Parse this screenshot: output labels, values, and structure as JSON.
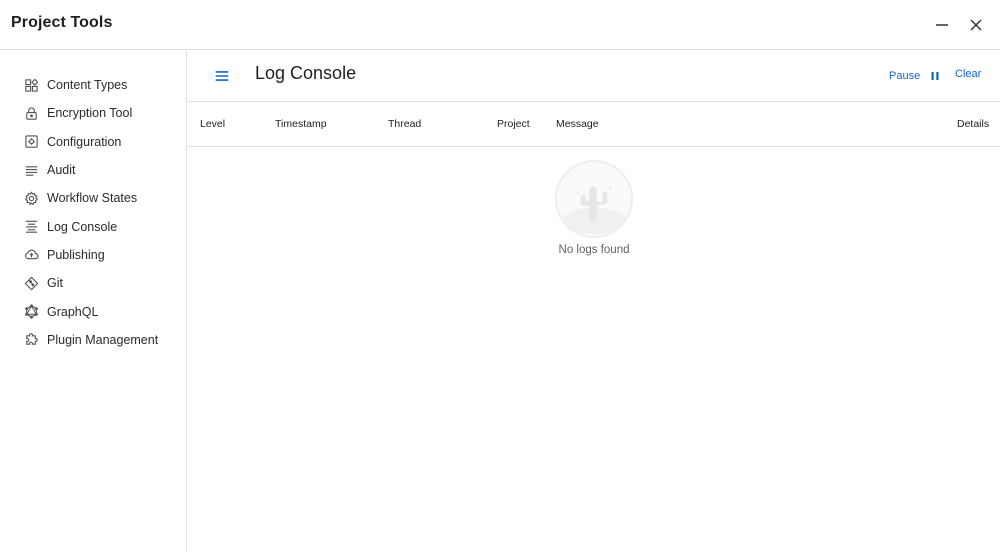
{
  "window": {
    "title": "Project Tools"
  },
  "sidebar": {
    "items": [
      {
        "label": "Content Types",
        "icon": "content-types-icon"
      },
      {
        "label": "Encryption Tool",
        "icon": "lock-icon"
      },
      {
        "label": "Configuration",
        "icon": "configuration-icon"
      },
      {
        "label": "Audit",
        "icon": "audit-icon"
      },
      {
        "label": "Workflow States",
        "icon": "gear-icon"
      },
      {
        "label": "Log Console",
        "icon": "log-console-icon"
      },
      {
        "label": "Publishing",
        "icon": "cloud-upload-icon"
      },
      {
        "label": "Git",
        "icon": "git-icon"
      },
      {
        "label": "GraphQL",
        "icon": "graphql-icon"
      },
      {
        "label": "Plugin Management",
        "icon": "puzzle-icon"
      }
    ]
  },
  "main": {
    "title": "Log Console",
    "pause_label": "Pause",
    "clear_label": "Clear",
    "columns": [
      "Level",
      "Timestamp",
      "Thread",
      "Project",
      "Message",
      "Details"
    ],
    "empty_message": "No logs found"
  },
  "colors": {
    "accent": "#1565c0",
    "border": "#e0e0e0",
    "text": "#202124"
  }
}
